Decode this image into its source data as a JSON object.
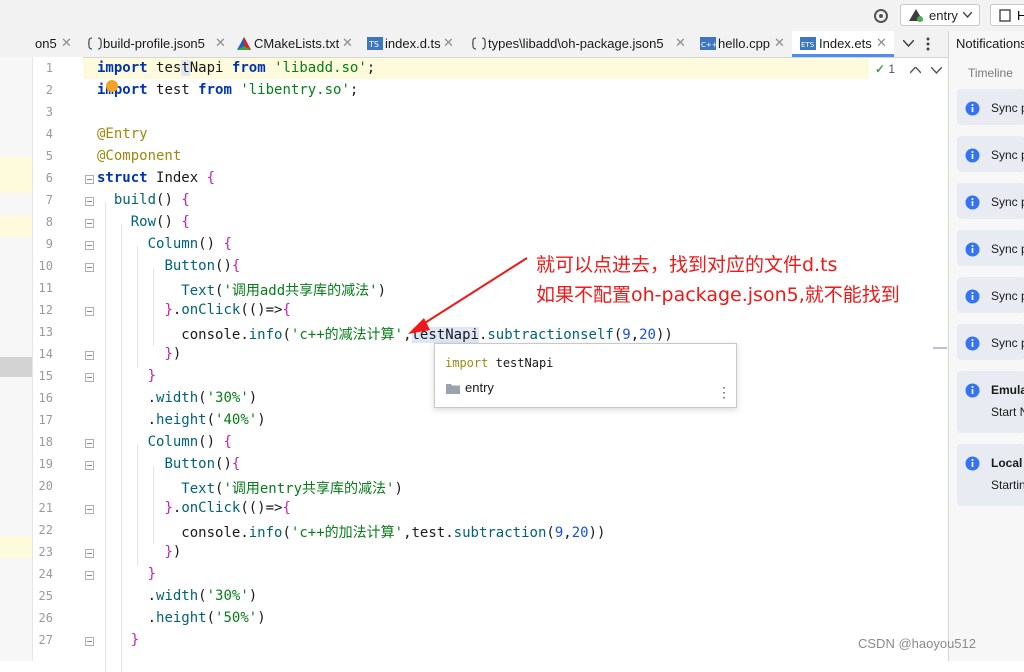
{
  "toolbar": {
    "gear_icon": "gear-icon",
    "entry_label": "entry",
    "right_label": "H"
  },
  "tabs": [
    {
      "label": "on5",
      "icon": ""
    },
    {
      "label": "build-profile.json5",
      "icon": "json-icon"
    },
    {
      "label": "CMakeLists.txt",
      "icon": "cmake-icon"
    },
    {
      "label": "index.d.ts",
      "icon": "ts-icon"
    },
    {
      "label": "types\\libadd\\oh-package.json5",
      "icon": "json-icon"
    },
    {
      "label": "hello.cpp",
      "icon": "cpp-icon"
    },
    {
      "label": "Index.ets",
      "icon": "ets-icon",
      "active": true
    }
  ],
  "editor": {
    "line_numbers": [
      "1",
      "2",
      "3",
      "4",
      "5",
      "6",
      "7",
      "8",
      "9",
      "10",
      "11",
      "12",
      "13",
      "14",
      "15",
      "16",
      "17",
      "18",
      "19",
      "20",
      "21",
      "22",
      "23",
      "24",
      "25",
      "26",
      "27"
    ],
    "inspection_count": "1",
    "lines": [
      "import testNapi from 'libadd.so';",
      "import test from 'libentry.so';",
      "",
      "@Entry",
      "@Component",
      "struct Index {",
      "  build() {",
      "    Row() {",
      "      Column() {",
      "        Button(){",
      "          Text('调用add共享库的减法')",
      "        }.onClick(()=>{",
      "          console.info('c++的减法计算',testNapi.subtractionself(9,20))",
      "        })",
      "      }",
      "      .width('30%')",
      "      .height('40%')",
      "      Column() {",
      "        Button(){",
      "          Text('调用entry共享库的减法')",
      "        }.onClick(()=>{",
      "          console.info('c++的加法计算',test.subtraction(9,20))",
      "        })",
      "      }",
      "      .width('30%')",
      "      .height('50%')",
      "    }"
    ]
  },
  "popup": {
    "signature": "import testNapi",
    "module": "entry"
  },
  "annotation": {
    "line1": "就可以点进去，找到对应的文件d.ts",
    "line2": "如果不配置oh-package.json5,就不能找到"
  },
  "notifications": {
    "title": "Notifications",
    "timeline": "Timeline",
    "items": [
      {
        "title": "Sync p",
        "sub": ""
      },
      {
        "title": "Sync p",
        "sub": ""
      },
      {
        "title": "Sync p",
        "sub": ""
      },
      {
        "title": "Sync p",
        "sub": ""
      },
      {
        "title": "Sync p",
        "sub": ""
      },
      {
        "title": "Sync p",
        "sub": ""
      },
      {
        "title": "Emula",
        "sub": "Start N"
      },
      {
        "title": "Local",
        "sub": "Startin"
      }
    ]
  },
  "watermark": "CSDN @haoyou512"
}
